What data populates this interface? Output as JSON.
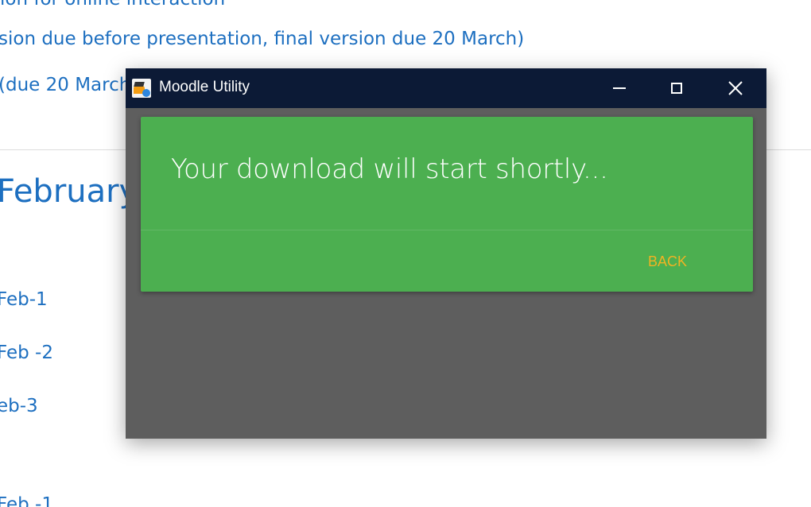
{
  "background_page": {
    "links": [
      "ion for online interaction",
      "sion due before presentation, final version due 20 March)",
      "(due 20 March)"
    ],
    "section_heading": "February",
    "items": [
      "Feb-1",
      "Feb -2",
      "eb-3",
      "Feb -1"
    ]
  },
  "window": {
    "title": "Moodle Utility",
    "icon": "moodle-utility-icon",
    "controls": {
      "minimize": "minimize-icon",
      "maximize": "maximize-icon",
      "close": "close-icon"
    },
    "titlebar_color": "#0c1a36",
    "body_color": "#5e5e5e"
  },
  "card": {
    "message": "Your download will start shortly...",
    "back_label": "BACK",
    "color": "#4caf50",
    "back_color": "#f0b323"
  }
}
